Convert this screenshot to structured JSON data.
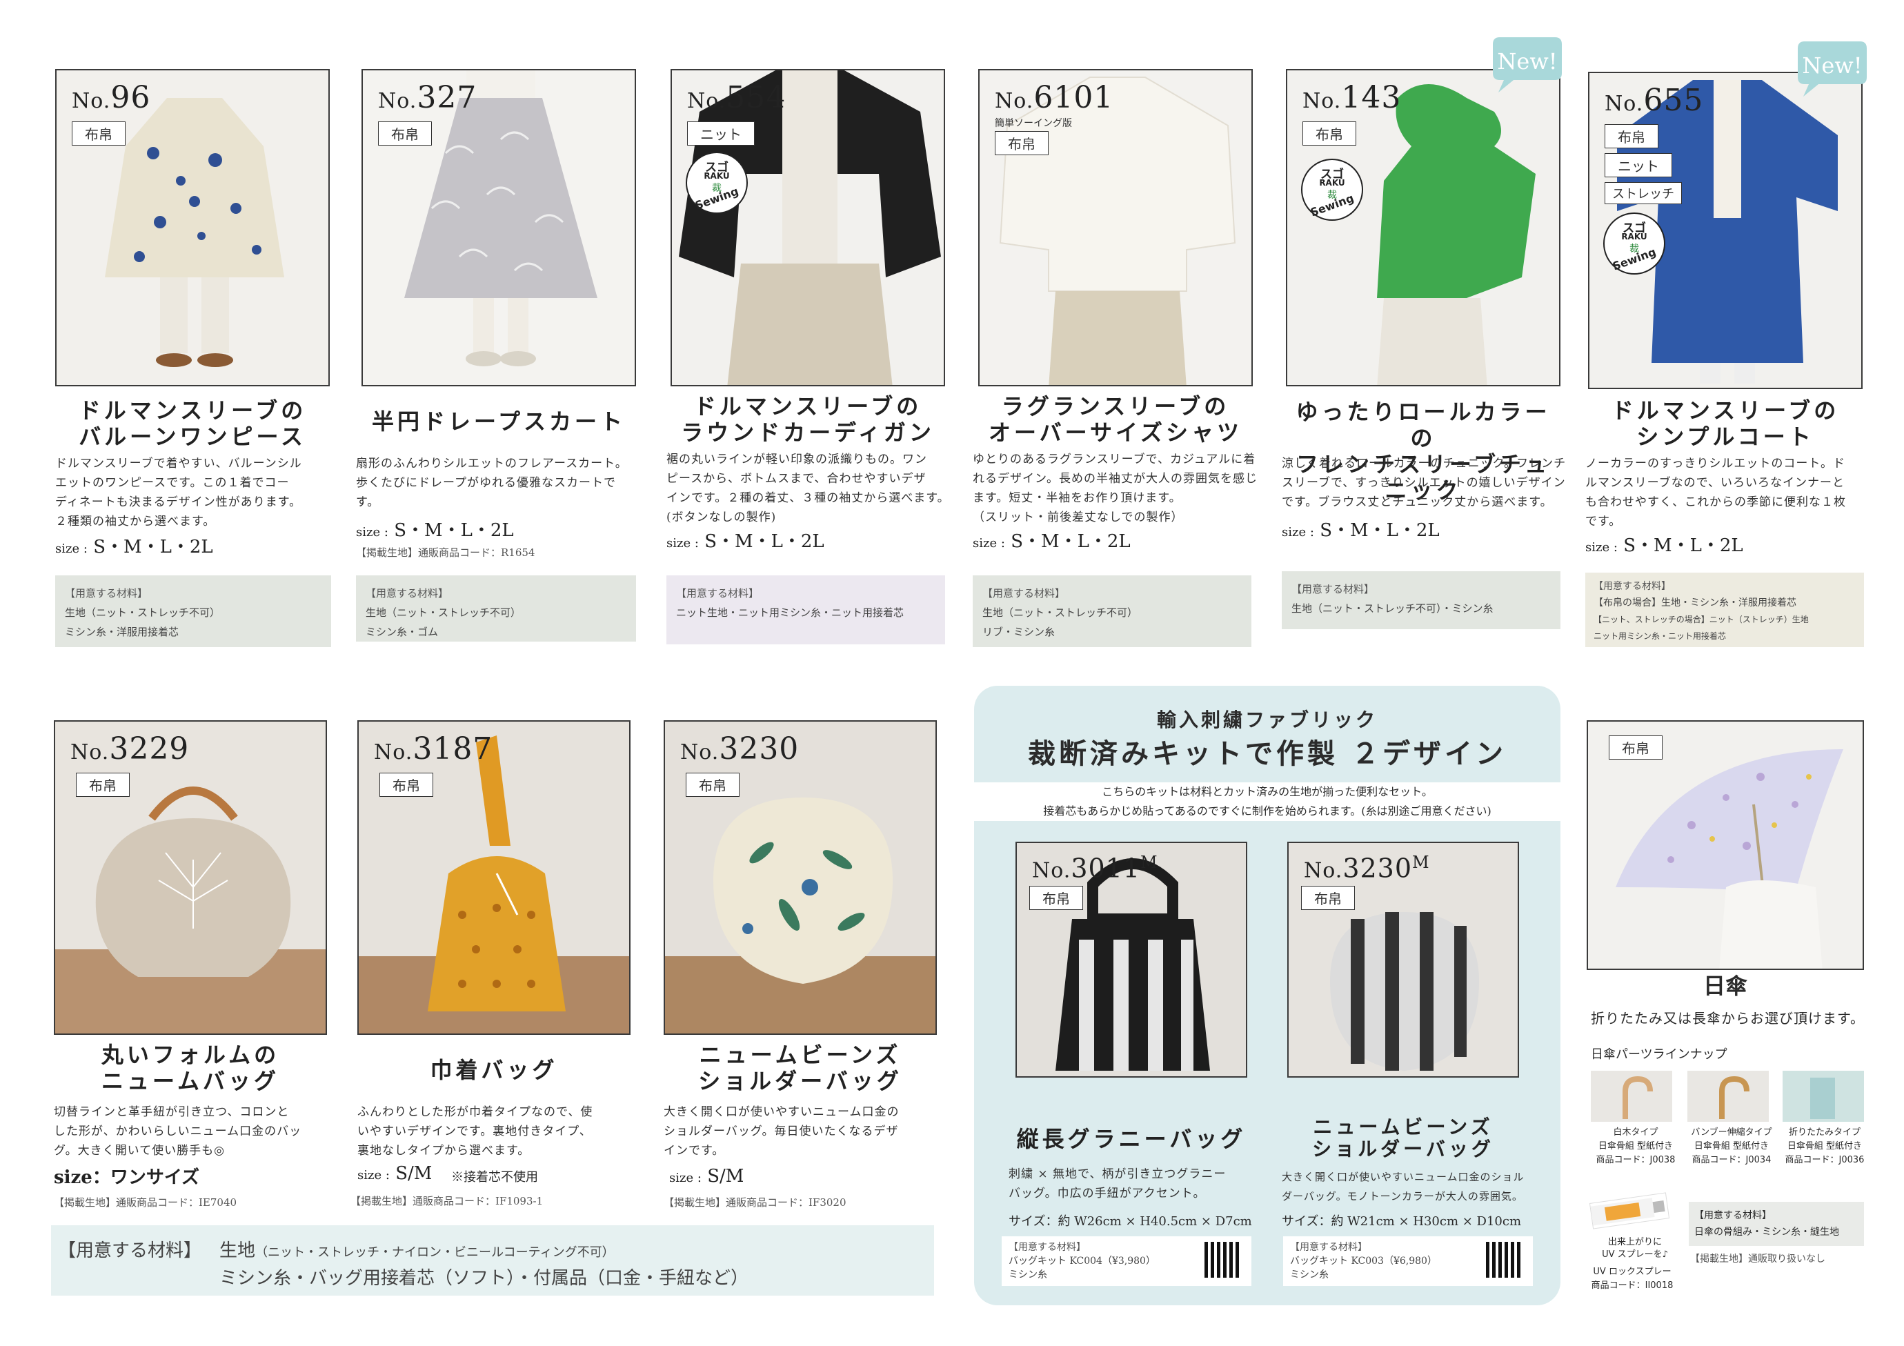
{
  "top_products": [
    {
      "no": "96",
      "tags": [
        "布帛"
      ],
      "sub": "",
      "title": [
        "ドルマンスリーブの",
        "バルーンワンピース"
      ],
      "desc": [
        "ドルマンスリーブで着やすい、バルーンシル",
        "エットのワンピースです。この１着でコー",
        "ディネートも決まるデザイン性があります。",
        "２種類の袖丈から選べます。"
      ],
      "size_label": "size :",
      "size": "S・M・L・2L",
      "code": "",
      "mat": [
        "【用意する材料】",
        "生地（ニット・ストレッチ不可）",
        "ミシン糸・洋服用接着芯"
      ]
    },
    {
      "no": "327",
      "tags": [
        "布帛"
      ],
      "sub": "",
      "title": [
        "半円ドレープスカート"
      ],
      "desc": [
        "扇形のふんわりシルエットのフレアースカート。",
        "歩くたびにドレープがゆれる優雅なスカートで",
        "す。"
      ],
      "size_label": "size :",
      "size": "S・M・L・2L",
      "code": "【掲載生地】通販商品コード：R1654",
      "mat": [
        "【用意する材料】",
        "生地（ニット・ストレッチ不可）",
        "ミシン糸・ゴム"
      ]
    },
    {
      "no": "554",
      "tags": [
        "ニット"
      ],
      "sub": "",
      "title": [
        "ドルマンスリーブの",
        "ラウンドカーディガン"
      ],
      "desc": [
        "裾の丸いラインが軽い印象の派織りもの。ワン",
        "ピースから、ボトムスまで、合わせやすいデザ",
        "インです。２種の着丈、３種の袖丈から選べます。",
        "(ボタンなしの製作)"
      ],
      "size_label": "size :",
      "size": "S・M・L・2L",
      "code": "",
      "mat": [
        "【用意する材料】",
        "ニット生地・ニット用ミシン糸・ニット用接着芯"
      ]
    },
    {
      "no": "6101",
      "tags": [
        "布帛"
      ],
      "sub": "簡単ソーイング版",
      "title": [
        "ラグランスリーブの",
        "オーバーサイズシャツ"
      ],
      "desc": [
        "ゆとりのあるラグランスリーブで、カジュアルに着",
        "れるデザイン。長めの半袖丈が大人の雰囲気を感じ",
        "ます。短丈・半袖をお作り頂けます。",
        "（スリット・前後差丈なしでの製作）"
      ],
      "size_label": "size :",
      "size": "S・M・L・2L",
      "code": "",
      "mat": [
        "【用意する材料】",
        "生地（ニット・ストレッチ不可）",
        "リブ・ミシン糸"
      ]
    },
    {
      "no": "143",
      "tags": [
        "布帛"
      ],
      "sub": "",
      "title": [
        "ゆったりロールカラーの",
        "フレンチスリーブチュニック"
      ],
      "desc": [
        "涼しく着れるロールカラーのチュニック。フレンチ",
        "スリーブで、すっきりシルエットの嬉しいデザイン",
        "です。ブラウス丈とチュニック丈から選べます。"
      ],
      "size_label": "size :",
      "size": "S・M・L・2L",
      "code": "",
      "mat": [
        "【用意する材料】",
        "生地（ニット・ストレッチ不可）・ミシン糸"
      ]
    },
    {
      "no": "655",
      "tags": [
        "布帛",
        "ニット",
        "ストレッチ"
      ],
      "sub": "",
      "title": [
        "ドルマンスリーブの",
        "シンプルコート"
      ],
      "desc": [
        "ノーカラーのすっきりシルエットのコート。ド",
        "ルマンスリーブなので、いろいろなインナーと",
        "も合わせやすく、これからの季節に便利な１枚",
        "です。"
      ],
      "size_label": "size :",
      "size": "S・M・L・2L",
      "code": "",
      "mat": [
        "【用意する材料】",
        "【布帛の場合】生地・ミシン糸・洋服用接着芯",
        "【ニット、ストレッチの場合】ニット（ストレッチ）生地",
        "ニット用ミシン糸・ニット用接着芯"
      ]
    }
  ],
  "bags": [
    {
      "no": "3229",
      "tag": "布帛",
      "title": [
        "丸いフォルムの",
        "ニュームバッグ"
      ],
      "desc": [
        "切替ラインと革手紐が引き立つ、コロンと",
        "した形が、かわいらしいニューム口金のバッ",
        "グ。大きく開いて使い勝手も◎"
      ],
      "size_label": "size：",
      "size": "ワンサイズ",
      "note": "",
      "code": "【掲載生地】通販商品コード：IE7040"
    },
    {
      "no": "3187",
      "tag": "布帛",
      "title": [
        "巾着バッグ"
      ],
      "desc": [
        "ふんわりとした形が巾着タイプなので、使",
        "いやすいデザインです。裏地付きタイプ、",
        "裏地なしタイプから選べます。"
      ],
      "size_label": "size :",
      "size": "S/M",
      "note": "※接着芯不使用",
      "code": "【掲載生地】通販商品コード：IF1093-1"
    },
    {
      "no": "3230",
      "tag": "布帛",
      "title": [
        "ニュームビーンズ",
        "ショルダーバッグ"
      ],
      "desc": [
        "大きく開く口が使いやすいニューム口金の",
        "ショルダーバッグ。毎日使いたくなるデザ",
        "インです。"
      ],
      "size_label": "size :",
      "size": "S/M",
      "note": "",
      "code": "【掲載生地】通販商品コード：IF3020"
    }
  ],
  "bag_materials": {
    "label": "【用意する材料】",
    "line1_main": "生地",
    "line1_note": "（ニット・ストレッチ・ナイロン・ビニールコーティング不可）",
    "line2": "ミシン糸・バッグ用接着芯（ソフト）・付属品（口金・手紐など）"
  },
  "kit": {
    "header_small": "輸入刺繍ファブリック",
    "header_big": "裁断済みキットで作製 ２デザイン",
    "intro1": "こちらのキットは材料とカット済みの生地が揃った便利なセット。",
    "intro2": "接着芯もあらかじめ貼ってあるのですぐに制作を始められます。(糸は別途ご用意ください)",
    "items": [
      {
        "no": "3011",
        "sup": "M",
        "tag": "布帛",
        "title": [
          "縦長グラニーバッグ"
        ],
        "desc": [
          "刺繍 × 無地で、柄が引き立つグラニー",
          "バッグ。巾広の手紐がアクセント。"
        ],
        "size": "サイズ：約 W26cm × H40.5cm × D7cm",
        "mat": [
          "【用意する材料】",
          "バッグキット KC004（¥3,980）",
          "ミシン糸"
        ]
      },
      {
        "no": "3230",
        "sup": "M",
        "tag": "布帛",
        "title": [
          "ニュームビーンズ",
          "ショルダーバッグ"
        ],
        "desc": [
          "大きく開く口が使いやすいニューム口金のショル",
          "ダーバッグ。モノトーンカラーが大人の雰囲気。"
        ],
        "size": "サイズ：約 W21cm × H30cm × D10cm",
        "mat": [
          "【用意する材料】",
          "バッグキット KC003（¥6,980）",
          "ミシン糸"
        ]
      }
    ]
  },
  "umbrella": {
    "tag": "布帛",
    "title": "日傘",
    "subtitle": "折りたたみ又は長傘からお選び頂けます。",
    "parts_heading": "日傘パーツラインナップ",
    "parts": [
      {
        "name": "白木タイプ",
        "desc": "日傘骨組 型紙付き",
        "code": "商品コード：J0038"
      },
      {
        "name": "バンブー伸縮タイプ",
        "desc": "日傘骨組 型紙付き",
        "code": "商品コード：J0034"
      },
      {
        "name": "折りたたみタイプ",
        "desc": "日傘骨組 型紙付き",
        "code": "商品コード：J0036"
      }
    ],
    "spray_note1": "出来上がりに",
    "spray_note2": "UV スプレーを♪",
    "spray_name": "UV ロックスプレー",
    "spray_code": "商品コード：II0018",
    "mat_label": "【用意する材料】",
    "mat_text": "日傘の骨組み・ミシン糸・縫生地",
    "fabric_note": "【掲載生地】通販取り扱いなし"
  },
  "badges": {
    "new": "New!",
    "raku_a": "スゴ",
    "raku_b": "RAKU",
    "raku_c": "裁",
    "raku_d": "Sewing"
  },
  "colors": {
    "mat_green": "#e2e6e0",
    "mat_purple": "#ece8f0",
    "mat_cream": "#edebe0",
    "kit_bg": "#dcecee",
    "bag_mat_bg": "#e6f1f1",
    "new_badge": "#a9d8da"
  }
}
